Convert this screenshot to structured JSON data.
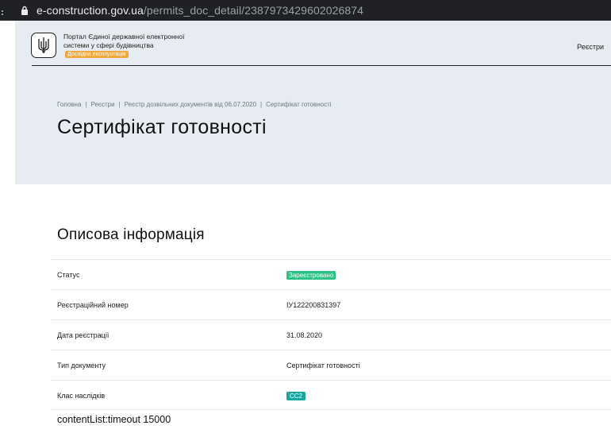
{
  "browser": {
    "url_domain": "e-construction.gov.ua",
    "url_path": "/permits_doc_detail/2387973429602026874"
  },
  "header": {
    "portal_title": "Портал Єдиної державної електронної системи у сфері будівництва",
    "beta_label": "Дослідна експлуатація",
    "nav_registries": "Реєстри"
  },
  "breadcrumb": [
    "Головна",
    "Реєстри",
    "Реєстр дозвільних документів від 06.07.2020",
    "Сертифікат готовності"
  ],
  "page_title": "Сертифікат готовності",
  "section_title": "Описова інформація",
  "info": {
    "status_label": "Статус",
    "status_value": "Зареєстровано",
    "reg_number_label": "Реєстраційний номер",
    "reg_number_value": "ІУ122200831397",
    "reg_date_label": "Дата реєстрації",
    "reg_date_value": "31.08.2020",
    "doc_type_label": "Тип документу",
    "doc_type_value": "Сертифікат готовності",
    "class_label": "Клас наслідків",
    "class_value": "СС2"
  },
  "debug_text": "contentList:timeout 15000",
  "colors": {
    "header_bg": "#e6ecf1",
    "status_green": "#2cc283",
    "class_teal": "#17a6a0",
    "beta_orange": "#f2a93b"
  },
  "icons": {
    "lock": "lock-icon",
    "emblem": "trident-emblem-icon"
  }
}
